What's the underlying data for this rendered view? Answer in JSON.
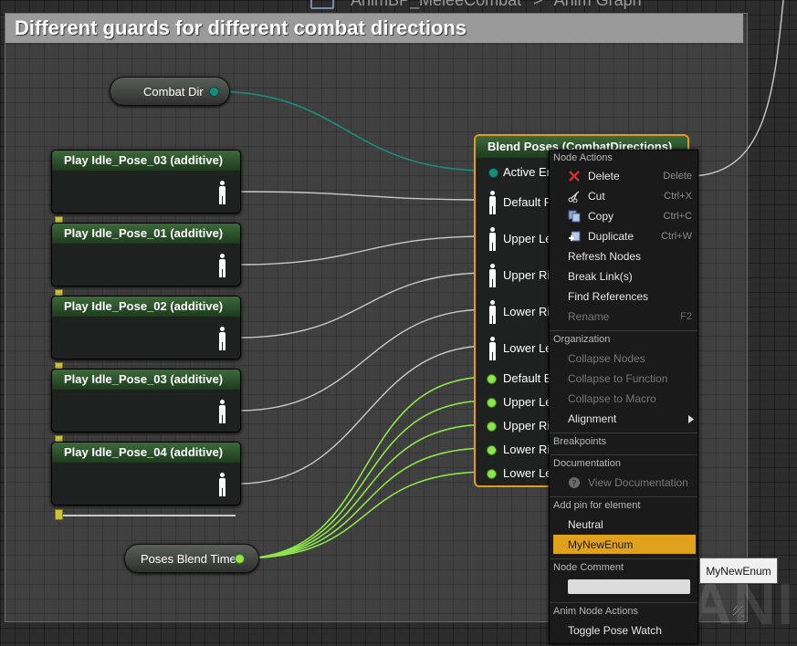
{
  "breadcrumb": {
    "asset": "AnimBP_MeleeCombat",
    "separator": ">",
    "graph": "Anim Graph"
  },
  "comment": {
    "title": "Different guards for different combat directions"
  },
  "variables": {
    "combat_dir": "Combat Dir",
    "poses_blend_time": "Poses Blend Time"
  },
  "play_nodes": [
    {
      "title": "Play Idle_Pose_03 (additive)"
    },
    {
      "title": "Play Idle_Pose_01 (additive)"
    },
    {
      "title": "Play Idle_Pose_02 (additive)"
    },
    {
      "title": "Play Idle_Pose_03 (additive)"
    },
    {
      "title": "Play Idle_Pose_04 (additive)"
    }
  ],
  "blend_node": {
    "title": "Blend Poses (CombatDirections)",
    "pins": [
      "Active En",
      "Default P",
      "Upper Lef",
      "Upper Rig",
      "Lower Rig",
      "Lower Lef",
      "Default B",
      "Upper Let",
      "Upper Rig",
      "Lower Rig",
      "Lower Lef"
    ]
  },
  "context_menu": {
    "node_actions": "Node Actions",
    "delete": {
      "label": "Delete",
      "shortcut": "Delete"
    },
    "cut": {
      "label": "Cut",
      "shortcut": "Ctrl+X"
    },
    "copy": {
      "label": "Copy",
      "shortcut": "Ctrl+C"
    },
    "duplicate": {
      "label": "Duplicate",
      "shortcut": "Ctrl+W"
    },
    "refresh_nodes": "Refresh Nodes",
    "break_links": "Break Link(s)",
    "find_references": "Find References",
    "rename": {
      "label": "Rename",
      "shortcut": "F2"
    },
    "organization": "Organization",
    "collapse_nodes": "Collapse Nodes",
    "collapse_to_function": "Collapse to Function",
    "collapse_to_macro": "Collapse to Macro",
    "alignment": "Alignment",
    "breakpoints": "Breakpoints",
    "documentation": "Documentation",
    "view_documentation": "View Documentation",
    "add_pin_for_element": "Add pin for element",
    "neutral": "Neutral",
    "my_new_enum": "MyNewEnum",
    "node_comment": "Node Comment",
    "anim_node_actions": "Anim Node Actions",
    "toggle_pose_watch": "Toggle Pose Watch"
  },
  "tooltip": "MyNewEnum",
  "watermark": "ANIM",
  "colors": {
    "selection_outline": "#e19d17",
    "highlight": "#e0a21c",
    "enum_wire": "#1a8c7a",
    "float_wire": "#8ee44c",
    "pose_wire": "#c8c8c8"
  }
}
